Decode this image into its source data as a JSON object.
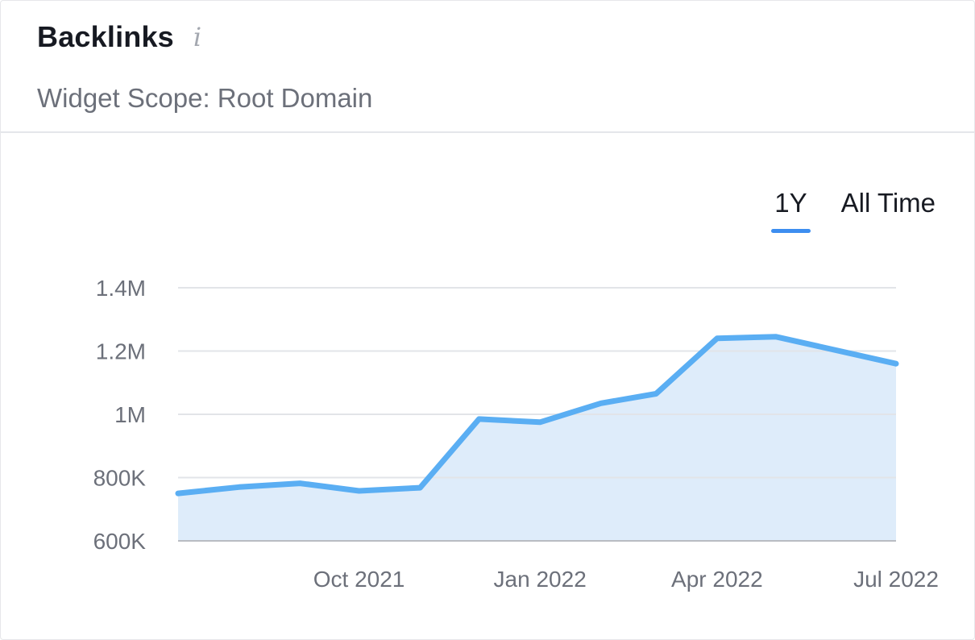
{
  "widget": {
    "title": "Backlinks",
    "info_icon": "info-icon",
    "subtitle": "Widget Scope: Root Domain"
  },
  "tabs": [
    {
      "label": "1Y",
      "active": true
    },
    {
      "label": "All Time",
      "active": false
    }
  ],
  "colors": {
    "line": "#5aaef3",
    "area": "#deecfa",
    "grid": "#e2e4e8",
    "baseline": "#b9bcc2",
    "active_tab": "#3d8ef0"
  },
  "chart_data": {
    "type": "area",
    "title": "",
    "xlabel": "",
    "ylabel": "",
    "ylim": [
      600000,
      1400000
    ],
    "y_ticks": [
      {
        "value": 1400000,
        "label": "1.4M"
      },
      {
        "value": 1200000,
        "label": "1.2M"
      },
      {
        "value": 1000000,
        "label": "1M"
      },
      {
        "value": 800000,
        "label": "800K"
      },
      {
        "value": 600000,
        "label": "600K"
      }
    ],
    "x_ticks": [
      {
        "date": "2021-10-01",
        "label": "Oct 2021"
      },
      {
        "date": "2022-01-01",
        "label": "Jan 2022"
      },
      {
        "date": "2022-04-01",
        "label": "Apr 2022"
      },
      {
        "date": "2022-07-01",
        "label": "Jul 2022"
      }
    ],
    "xlim": [
      "2021-07-01",
      "2022-07-01"
    ],
    "grid": true,
    "series": [
      {
        "points": [
          {
            "x": "2021-07-01",
            "y": 750000
          },
          {
            "x": "2021-08-01",
            "y": 770000
          },
          {
            "x": "2021-09-01",
            "y": 782000
          },
          {
            "x": "2021-10-01",
            "y": 758000
          },
          {
            "x": "2021-11-01",
            "y": 768000
          },
          {
            "x": "2021-12-01",
            "y": 985000
          },
          {
            "x": "2022-01-01",
            "y": 975000
          },
          {
            "x": "2022-02-01",
            "y": 1035000
          },
          {
            "x": "2022-03-01",
            "y": 1065000
          },
          {
            "x": "2022-04-01",
            "y": 1240000
          },
          {
            "x": "2022-05-01",
            "y": 1245000
          },
          {
            "x": "2022-07-01",
            "y": 1160000
          }
        ]
      }
    ]
  }
}
